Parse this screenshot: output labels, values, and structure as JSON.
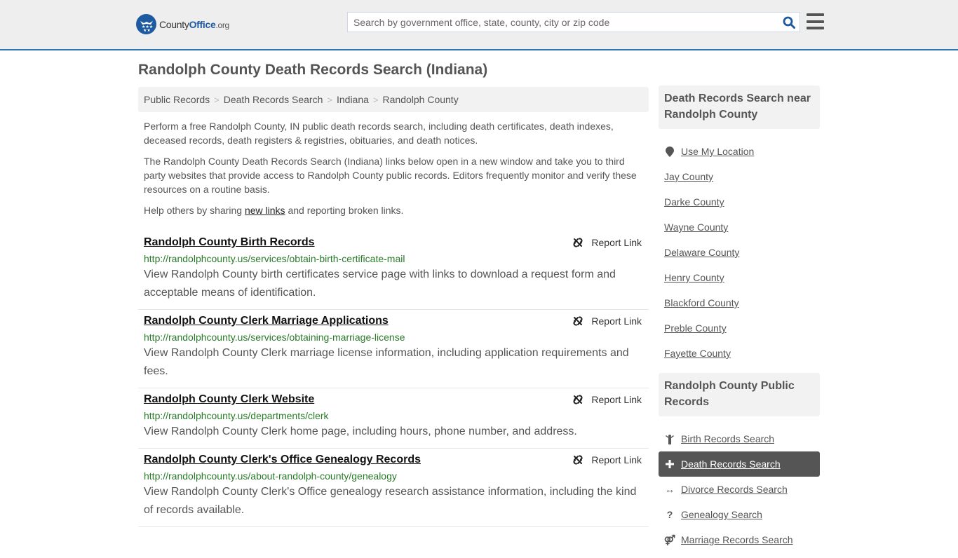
{
  "header": {
    "logo": {
      "county": "County",
      "office": "Office",
      "tld": ".org"
    },
    "search": {
      "placeholder": "Search by government office, state, county, city or zip code",
      "value": ""
    }
  },
  "page_title": "Randolph County Death Records Search (Indiana)",
  "breadcrumb": [
    {
      "label": "Public Records"
    },
    {
      "label": "Death Records Search"
    },
    {
      "label": "Indiana"
    },
    {
      "label": "Randolph County"
    }
  ],
  "breadcrumb_separator": ">",
  "intro": {
    "p1": "Perform a free Randolph County, IN public death records search, including death certificates, death indexes, deceased records, death registers & registries, obituaries, and death notices.",
    "p2": "The Randolph County Death Records Search (Indiana) links below open in a new window and take you to third party websites that provide access to Randolph County public records. Editors frequently monitor and verify these resources on a routine basis.",
    "p3_before": "Help others by sharing ",
    "p3_link": "new links",
    "p3_after": " and reporting broken links."
  },
  "report_label": "Report Link",
  "results": [
    {
      "title": "Randolph County Birth Records",
      "url": "http://randolphcounty.us/services/obtain-birth-certificate-mail",
      "description": "View Randolph County birth certificates service page with links to download a request form and acceptable means of identification."
    },
    {
      "title": "Randolph County Clerk Marriage Applications",
      "url": "http://randolphcounty.us/services/obtaining-marriage-license",
      "description": "View Randolph County Clerk marriage license information, including application requirements and fees."
    },
    {
      "title": "Randolph County Clerk Website",
      "url": "http://randolphcounty.us/departments/clerk",
      "description": "View Randolph County Clerk home page, including hours, phone number, and address."
    },
    {
      "title": "Randolph County Clerk's Office Genealogy Records",
      "url": "http://randolphcounty.us/about-randolph-county/genealogy",
      "description": "View Randolph County Clerk's Office genealogy research assistance information, including the kind of records available."
    }
  ],
  "sidebar": {
    "nearby": {
      "heading": "Death Records Search near Randolph County",
      "use_location": {
        "label": "Use My Location",
        "icon": "map-marker-icon"
      },
      "counties": [
        "Jay County",
        "Darke County",
        "Wayne County",
        "Delaware County",
        "Henry County",
        "Blackford County",
        "Preble County",
        "Fayette County"
      ]
    },
    "public_records": {
      "heading": "Randolph County Public Records",
      "items": [
        {
          "label": "Birth Records Search",
          "icon": "child-icon",
          "glyph": "ὫC",
          "active": false
        },
        {
          "label": "Death Records Search",
          "icon": "plus-icon",
          "glyph": "+",
          "active": true
        },
        {
          "label": "Divorce Records Search",
          "icon": "arrows-horizontal-icon",
          "glyph": "↔",
          "active": false
        },
        {
          "label": "Genealogy Search",
          "icon": "question-icon",
          "glyph": "?",
          "active": false
        },
        {
          "label": "Marriage Records Search",
          "icon": "venus-mars-icon",
          "glyph": "⚤",
          "active": false
        }
      ]
    }
  },
  "colors": {
    "brand_blue": "#1e5aa0",
    "header_border": "#3278b0",
    "url_green": "#2a7a2a",
    "active_bg": "#555555"
  }
}
